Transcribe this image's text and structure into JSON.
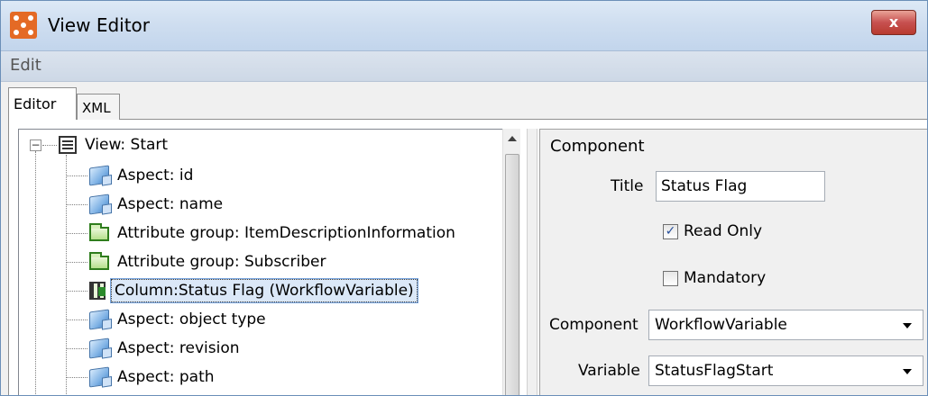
{
  "window": {
    "title": "View Editor",
    "close_label": "x"
  },
  "menu": {
    "edit": "Edit"
  },
  "tabs": [
    {
      "label": "Editor"
    },
    {
      "label": "XML"
    }
  ],
  "tree": {
    "root": "View: Start",
    "items": [
      {
        "label": "Aspect: id",
        "icon": "aspect-icon"
      },
      {
        "label": "Aspect: name",
        "icon": "aspect-icon"
      },
      {
        "label": "Attribute group: ItemDescriptionInformation",
        "icon": "folder-icon"
      },
      {
        "label": "Attribute group: Subscriber",
        "icon": "folder-icon"
      },
      {
        "label": "Column:Status Flag (WorkflowVariable)",
        "icon": "column-icon",
        "selected": true
      },
      {
        "label": "Aspect: object type",
        "icon": "aspect-icon"
      },
      {
        "label": "Aspect: revision",
        "icon": "aspect-icon"
      },
      {
        "label": "Aspect: path",
        "icon": "aspect-icon"
      }
    ]
  },
  "properties": {
    "heading": "Component",
    "title_label": "Title",
    "title_value": "Status Flag",
    "read_only_label": "Read Only",
    "read_only_checked": true,
    "mandatory_label": "Mandatory",
    "mandatory_checked": false,
    "component_label": "Component",
    "component_value": "WorkflowVariable",
    "variable_label": "Variable",
    "variable_value": "StatusFlagStart"
  }
}
